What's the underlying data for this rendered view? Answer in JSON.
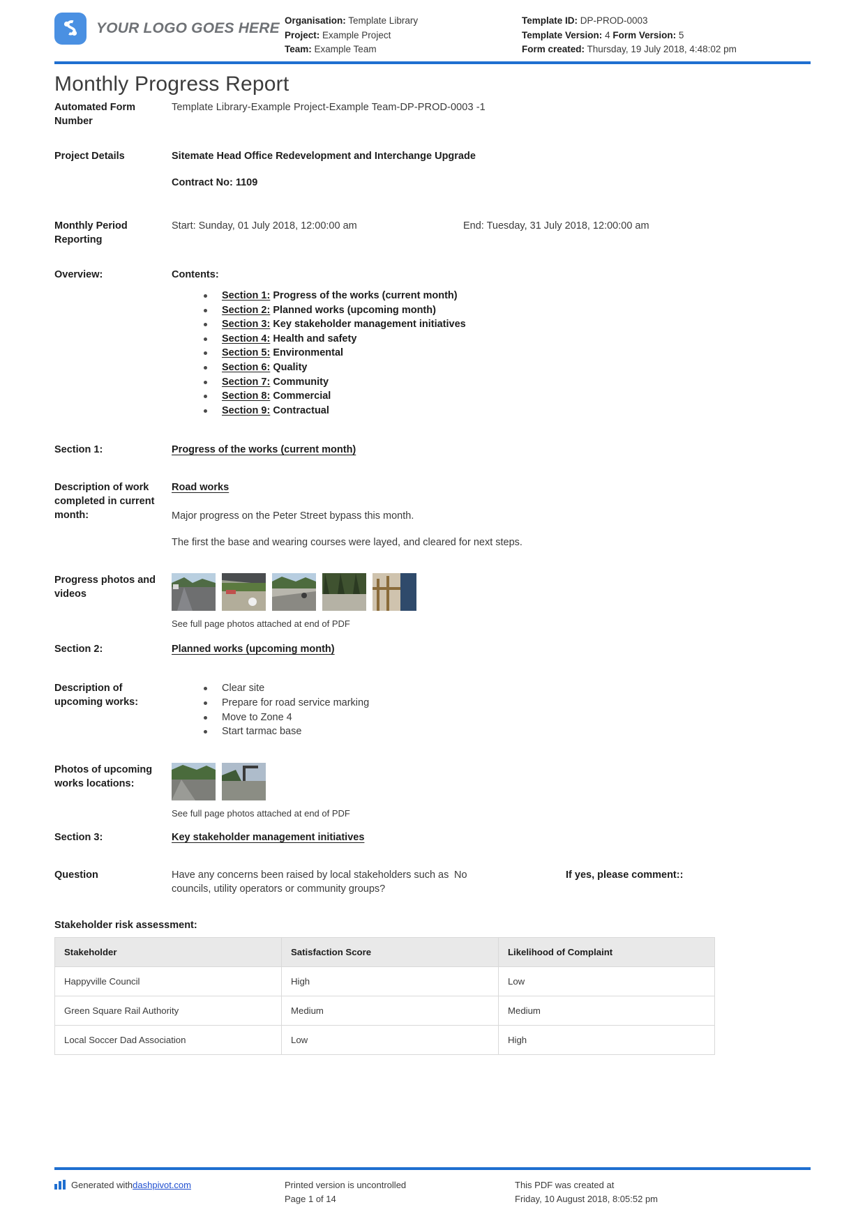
{
  "header": {
    "logo_text": "YOUR LOGO GOES HERE",
    "left": {
      "organisation_label": "Organisation:",
      "organisation_value": "Template Library",
      "project_label": "Project:",
      "project_value": "Example Project",
      "team_label": "Team:",
      "team_value": "Example Team"
    },
    "right": {
      "template_id_label": "Template ID:",
      "template_id_value": "DP-PROD-0003",
      "template_version_label": "Template Version:",
      "template_version_value": "4",
      "form_version_label": "Form Version:",
      "form_version_value": "5",
      "form_created_label": "Form created:",
      "form_created_value": "Thursday, 19 July 2018, 4:48:02 pm"
    }
  },
  "title": "Monthly Progress Report",
  "form_number": {
    "label": "Automated Form Number",
    "value": "Template Library-Example Project-Example Team-DP-PROD-0003   -1"
  },
  "project_details": {
    "label": "Project Details",
    "value": "Sitemate Head Office Redevelopment and Interchange Upgrade",
    "contract": "Contract No: 1109"
  },
  "monthly_period": {
    "label": "Monthly Period Reporting",
    "start": "Start: Sunday, 01 July 2018, 12:00:00 am",
    "end": "End: Tuesday, 31 July 2018, 12:00:00 am"
  },
  "overview": {
    "label": "Overview:",
    "contents_label": "Contents:",
    "items": [
      {
        "section": "Section 1:",
        "title": "Progress of the works (current month)"
      },
      {
        "section": "Section 2:",
        "title": "Planned works (upcoming month)"
      },
      {
        "section": "Section 3:",
        "title": "Key stakeholder management initiatives"
      },
      {
        "section": "Section 4:",
        "title": "Health and safety"
      },
      {
        "section": "Section 5:",
        "title": "Environmental"
      },
      {
        "section": "Section 6:",
        "title": "Quality"
      },
      {
        "section": "Section 7:",
        "title": "Community"
      },
      {
        "section": "Section 8:",
        "title": "Commercial"
      },
      {
        "section": "Section 9:",
        "title": "Contractual"
      }
    ]
  },
  "section1": {
    "label": "Section 1:",
    "heading": "Progress of the works (current month)",
    "desc_label": "Description of work completed in current month:",
    "subheading": "Road works",
    "para1": "Major progress on the Peter Street bypass this month.",
    "para2": "The first the base and wearing courses were layed, and cleared for next steps.",
    "photos_label": "Progress photos and videos",
    "photos_caption": "See full page photos attached at end of PDF"
  },
  "section2": {
    "label": "Section 2:",
    "heading": "Planned works (upcoming month)",
    "desc_label": "Description of upcoming works:",
    "items": [
      "Clear site",
      "Prepare for road service marking",
      "Move to Zone 4",
      "Start tarmac base"
    ],
    "photos_label": "Photos of upcoming works locations:",
    "photos_caption": "See full page photos attached at end of PDF"
  },
  "section3": {
    "label": "Section 3:",
    "heading": "Key stakeholder management initiatives",
    "question_label": "Question",
    "question_text": "Have any concerns been raised by local stakeholders such as councils, utility operators or community groups?",
    "answer": "No",
    "if_yes_label": "If yes, please comment::",
    "table_title": "Stakeholder risk assessment:",
    "table": {
      "headers": [
        "Stakeholder",
        "Satisfaction Score",
        "Likelihood of Complaint"
      ],
      "rows": [
        [
          "Happyville Council",
          "High",
          "Low"
        ],
        [
          "Green Square Rail Authority",
          "Medium",
          "Medium"
        ],
        [
          "Local Soccer Dad Association",
          "Low",
          "High"
        ]
      ]
    }
  },
  "footer": {
    "generated_prefix": "Generated with ",
    "generated_link": "dashpivot.com",
    "printed_line1": "Printed version is uncontrolled",
    "printed_line2": "Page 1 of 14",
    "created_line1": "This PDF was created at",
    "created_line2": "Friday, 10 August 2018, 8:05:52 pm"
  },
  "colors": {
    "accent_blue": "#1f6fd0",
    "logo_blue": "#4a90e2",
    "link_blue": "#1f4fd0",
    "table_header_bg": "#e9e9e9"
  }
}
